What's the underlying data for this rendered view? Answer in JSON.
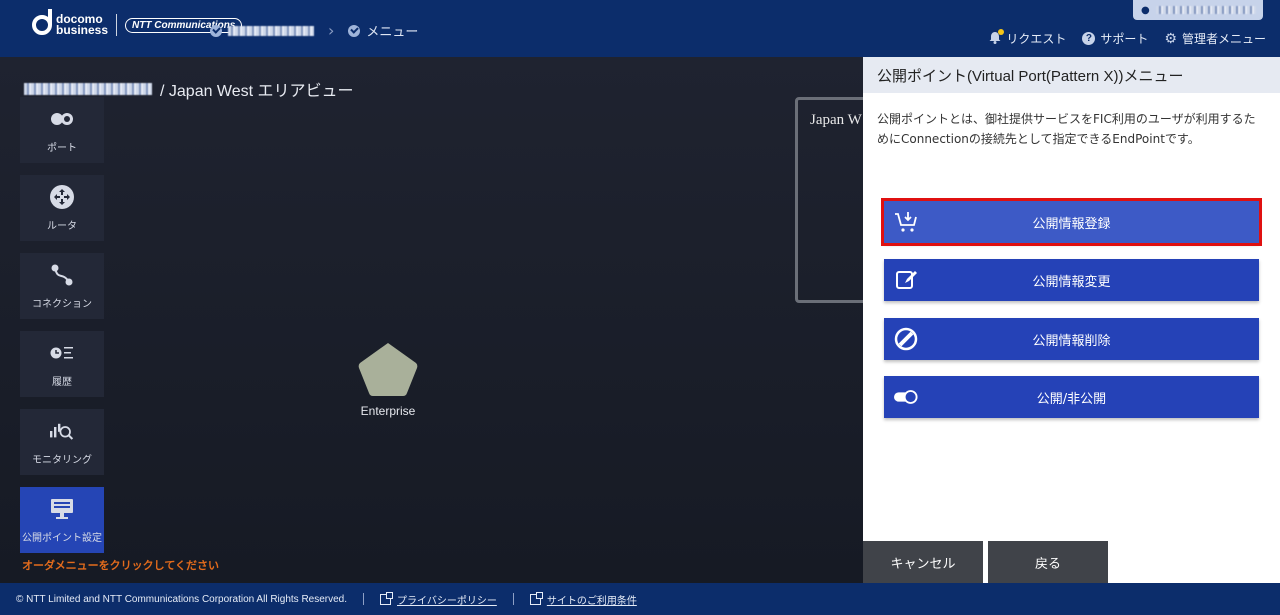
{
  "header": {
    "logo": {
      "line1": "docomo",
      "line2": "business",
      "partner": "NTT Communications"
    },
    "breadcrumb": {
      "tenant": "",
      "current": "メニュー"
    },
    "nav": {
      "request": "リクエスト",
      "support": "サポート",
      "admin_menu": "管理者メニュー"
    }
  },
  "canvas": {
    "title_suffix": "/ Japan West エリアビュー",
    "sidebar": [
      {
        "label": "ポート",
        "icon": "port-icon"
      },
      {
        "label": "ルータ",
        "icon": "router-icon"
      },
      {
        "label": "コネクション",
        "icon": "connection-icon"
      },
      {
        "label": "履歴",
        "icon": "history-icon"
      },
      {
        "label": "モニタリング",
        "icon": "monitoring-icon"
      },
      {
        "label": "公開ポイント設定",
        "icon": "public-point-icon"
      }
    ],
    "hint": "オーダメニューをクリックしてください",
    "node": {
      "label": "Enterprise",
      "color": "#a9b09a"
    },
    "region_label": "Japan W"
  },
  "panel": {
    "title": "公開ポイント(Virtual Port(Pattern X))メニュー",
    "description": "公開ポイントとは、御社提供サービスをFIC利用のユーザが利用するためにConnectionの接続先として指定できるEndPointです。",
    "buttons": [
      {
        "label": "公開情報登録",
        "icon": "cart-download-icon"
      },
      {
        "label": "公開情報変更",
        "icon": "edit-icon"
      },
      {
        "label": "公開情報削除",
        "icon": "prohibit-icon"
      },
      {
        "label": "公開/非公開",
        "icon": "toggle-icon"
      }
    ],
    "cancel": "キャンセル",
    "back": "戻る"
  },
  "footer": {
    "copyright": "© NTT Limited and NTT Communications Corporation All Rights Reserved.",
    "privacy": "プライバシーポリシー",
    "terms": "サイトのご利用条件"
  },
  "colors": {
    "header": "#0c2d6b",
    "primary_button": "#2542b7",
    "highlight": "#e01010",
    "hint": "#e36b1c"
  }
}
